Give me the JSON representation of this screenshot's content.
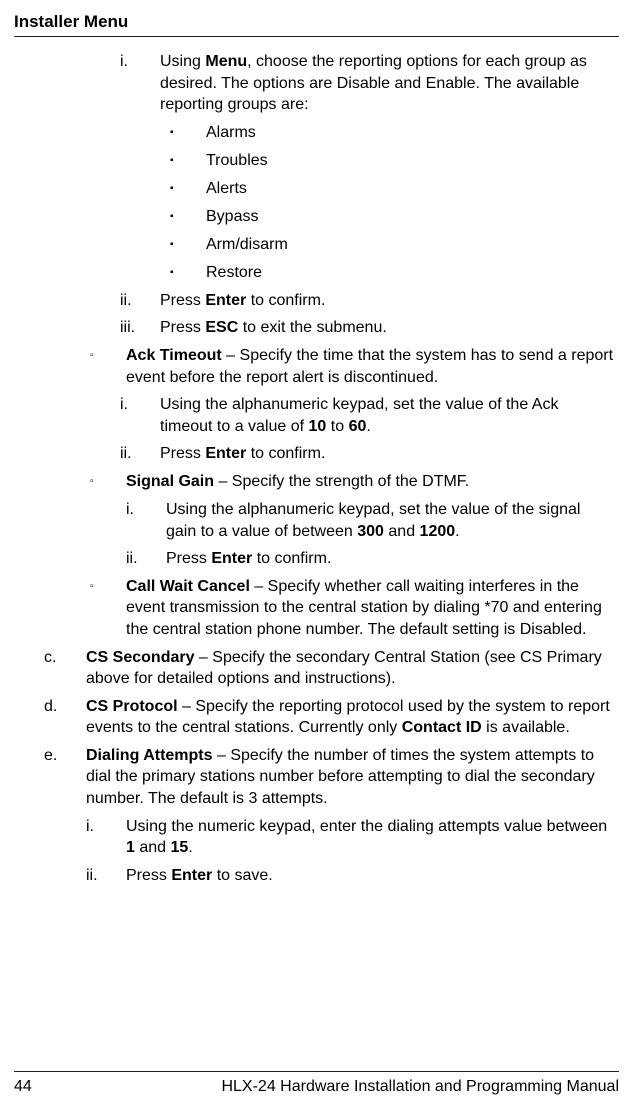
{
  "header": "Installer Menu",
  "i_text": "Using <b>Menu</b>, choose the reporting options for each group as desired. The options are Disable and Enable. The available reporting groups are:",
  "bullets": [
    "Alarms",
    "Troubles",
    "Alerts",
    "Bypass",
    "Arm/disarm",
    "Restore"
  ],
  "ii_text": "Press <b>Enter</b> to confirm.",
  "iii_text": "Press <b>ESC</b> to exit the submenu.",
  "ack_timeout": "<b>Ack Timeout</b> – Specify the time that the system has to send a report event before the report alert is discontinued.",
  "ack_i": "Using the alphanumeric keypad, set the value of the Ack timeout to a value of <b>10</b> to <b>60</b>.",
  "ack_ii": "Press <b>Enter</b> to confirm.",
  "signal_gain": "<b>Signal Gain</b> – Specify the strength of the DTMF.",
  "sg_i": "Using the alphanumeric keypad, set the value of the signal gain to a value of between <b>300</b> and <b>1200</b>.",
  "sg_ii": "Press <b>Enter</b> to confirm.",
  "call_wait": "<b>Call Wait Cancel</b> – Specify whether call waiting interferes in the event transmission to the central station by dialing *70 and entering the central station phone number. The default setting is Disabled.",
  "c_text": "<b>CS Secondary</b> – Specify the secondary Central Station (see CS Primary above for detailed options and instructions).",
  "d_text": "<b>CS Protocol</b> – Specify the reporting protocol used by the system to report events to the central stations. Currently only <b>Contact ID</b> is available.",
  "e_text": "<b>Dialing Attempts</b> – Specify the number of times the system attempts to dial the primary stations number before attempting to dial the secondary number. The default is 3 attempts.",
  "e_i": "Using the numeric keypad, enter the dialing attempts value between <b>1</b> and <b>15</b>.",
  "e_ii": "Press <b>Enter</b> to save.",
  "footer_page": "44",
  "footer_title": "HLX-24 Hardware Installation and Programming Manual",
  "markers": {
    "i": "i.",
    "ii": "ii.",
    "iii": "iii.",
    "c": "c.",
    "d": "d.",
    "e": "e.",
    "square": "▫",
    "bullet": "▪"
  }
}
